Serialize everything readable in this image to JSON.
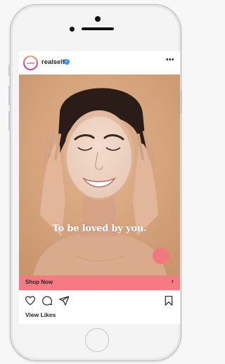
{
  "post": {
    "avatar_text": "realself",
    "username": "realself",
    "verified_glyph": "✓",
    "more_glyph": "•••",
    "caption": "To be loved by you.",
    "shop_label": "Shop Now",
    "shop_chevron": "›",
    "likes_label": "View Likes"
  },
  "icons": {
    "like": "heart-icon",
    "comment": "comment-icon",
    "share": "send-icon",
    "save": "bookmark-icon"
  },
  "colors": {
    "accent_pink": "#f37b82",
    "verified_blue": "#3897f0",
    "photo_background": "#d6a882"
  }
}
